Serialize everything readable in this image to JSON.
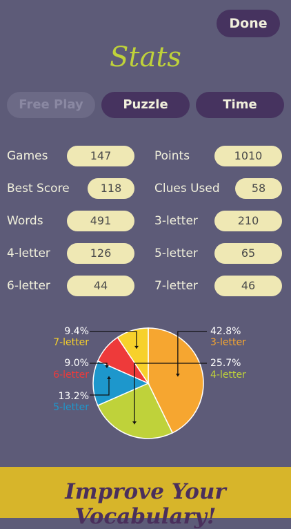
{
  "header": {
    "done_label": "Done",
    "title": "Stats"
  },
  "tabs": [
    {
      "label": "Free Play",
      "state": "disabled"
    },
    {
      "label": "Puzzle",
      "state": "enabled"
    },
    {
      "label": "Time",
      "state": "enabled"
    }
  ],
  "stats": {
    "games_label": "Games",
    "games_value": "147",
    "points_label": "Points",
    "points_value": "1010",
    "best_score_label": "Best Score",
    "best_score_value": "118",
    "clues_used_label": "Clues Used",
    "clues_used_value": "58",
    "words_label": "Words",
    "words_value": "491",
    "three_letter_label": "3-letter",
    "three_letter_value": "210",
    "four_letter_label": "4-letter",
    "four_letter_value": "126",
    "five_letter_label": "5-letter",
    "five_letter_value": "65",
    "six_letter_label": "6-letter",
    "six_letter_value": "44",
    "seven_letter_label": "7-letter",
    "seven_letter_value": "46"
  },
  "chart_data": {
    "type": "pie",
    "slices": [
      {
        "label": "3-letter",
        "pct_text": "42.8%",
        "value": 42.8,
        "color": "#f6a630"
      },
      {
        "label": "4-letter",
        "pct_text": "25.7%",
        "value": 25.7,
        "color": "#bfd23a"
      },
      {
        "label": "5-letter",
        "pct_text": "13.2%",
        "value": 13.2,
        "color": "#1d97cc"
      },
      {
        "label": "6-letter",
        "pct_text": "9.0%",
        "value": 9.0,
        "color": "#ee3a3a"
      },
      {
        "label": "7-letter",
        "pct_text": "9.4%",
        "value": 9.4,
        "color": "#f7d12b"
      }
    ]
  },
  "banner": {
    "text": "Improve Your Vocabulary!"
  }
}
